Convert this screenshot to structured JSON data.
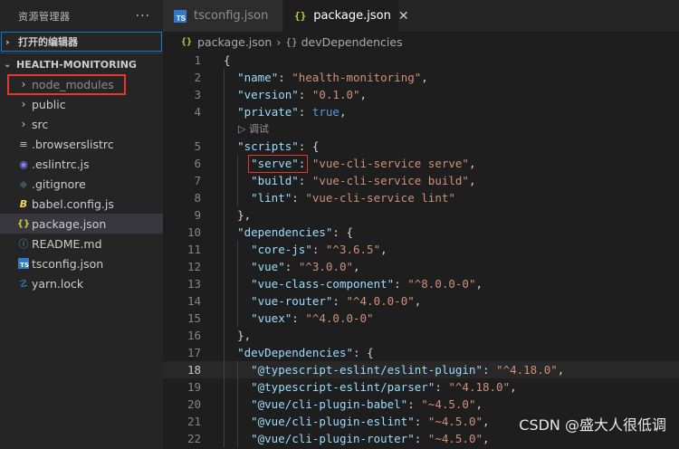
{
  "sidebar": {
    "title": "资源管理器",
    "more": "···",
    "open_editors": "打开的编辑器",
    "project": "HEALTH-MONITORING",
    "items": [
      {
        "label": "node_modules",
        "icon": "chevron-right-icon",
        "glyph": "›"
      },
      {
        "label": "public",
        "icon": "chevron-right-icon",
        "glyph": "›"
      },
      {
        "label": "src",
        "icon": "chevron-right-icon",
        "glyph": "›"
      },
      {
        "label": ".browserslistrc",
        "icon": "lines-icon",
        "glyph": "≡"
      },
      {
        "label": ".eslintrc.js",
        "icon": "eslint-icon",
        "glyph": "◉"
      },
      {
        "label": ".gitignore",
        "icon": "git-icon",
        "glyph": "◆"
      },
      {
        "label": "babel.config.js",
        "icon": "babel-icon",
        "glyph": "B"
      },
      {
        "label": "package.json",
        "icon": "json-icon",
        "glyph": "{}"
      },
      {
        "label": "README.md",
        "icon": "info-icon",
        "glyph": "ⓘ"
      },
      {
        "label": "tsconfig.json",
        "icon": "typescript-icon",
        "glyph": "TS"
      },
      {
        "label": "yarn.lock",
        "icon": "yarn-icon",
        "glyph": "☡"
      }
    ]
  },
  "tabs": [
    {
      "label": "tsconfig.json",
      "icon": "typescript-icon",
      "glyph": "TS"
    },
    {
      "label": "package.json",
      "icon": "json-icon",
      "glyph": "{}",
      "close": "✕"
    }
  ],
  "breadcrumb": {
    "file": "package.json",
    "file_glyph": "{}",
    "sep": "›",
    "obj_glyph": "{}",
    "node": "devDependencies"
  },
  "editor": {
    "lens": "▷ 调试",
    "lines": [
      {
        "n": "1",
        "code": "{"
      },
      {
        "n": "2",
        "code": "  \"name\": \"health-monitoring\","
      },
      {
        "n": "3",
        "code": "  \"version\": \"0.1.0\","
      },
      {
        "n": "4",
        "code": "  \"private\": true,"
      },
      {
        "n": "5",
        "code": "  \"scripts\": {"
      },
      {
        "n": "6",
        "code": "    \"serve\": \"vue-cli-service serve\","
      },
      {
        "n": "7",
        "code": "    \"build\": \"vue-cli-service build\","
      },
      {
        "n": "8",
        "code": "    \"lint\": \"vue-cli-service lint\""
      },
      {
        "n": "9",
        "code": "  },"
      },
      {
        "n": "10",
        "code": "  \"dependencies\": {"
      },
      {
        "n": "11",
        "code": "    \"core-js\": \"^3.6.5\","
      },
      {
        "n": "12",
        "code": "    \"vue\": \"^3.0.0\","
      },
      {
        "n": "13",
        "code": "    \"vue-class-component\": \"^8.0.0-0\","
      },
      {
        "n": "14",
        "code": "    \"vue-router\": \"^4.0.0-0\","
      },
      {
        "n": "15",
        "code": "    \"vuex\": \"^4.0.0-0\""
      },
      {
        "n": "16",
        "code": "  },"
      },
      {
        "n": "17",
        "code": "  \"devDependencies\": {"
      },
      {
        "n": "18",
        "code": "    \"@typescript-eslint/eslint-plugin\": \"^4.18.0\","
      },
      {
        "n": "19",
        "code": "    \"@typescript-eslint/parser\": \"^4.18.0\","
      },
      {
        "n": "20",
        "code": "    \"@vue/cli-plugin-babel\": \"~4.5.0\","
      },
      {
        "n": "21",
        "code": "    \"@vue/cli-plugin-eslint\": \"~4.5.0\","
      },
      {
        "n": "22",
        "code": "    \"@vue/cli-plugin-router\": \"~4.5.0\","
      }
    ]
  },
  "watermark": "CSDN @盛大人很低调",
  "colors": {
    "accent": "#007fd4",
    "highlight_box": "#e8362c",
    "string": "#ce9178",
    "key": "#9cdcfe"
  }
}
